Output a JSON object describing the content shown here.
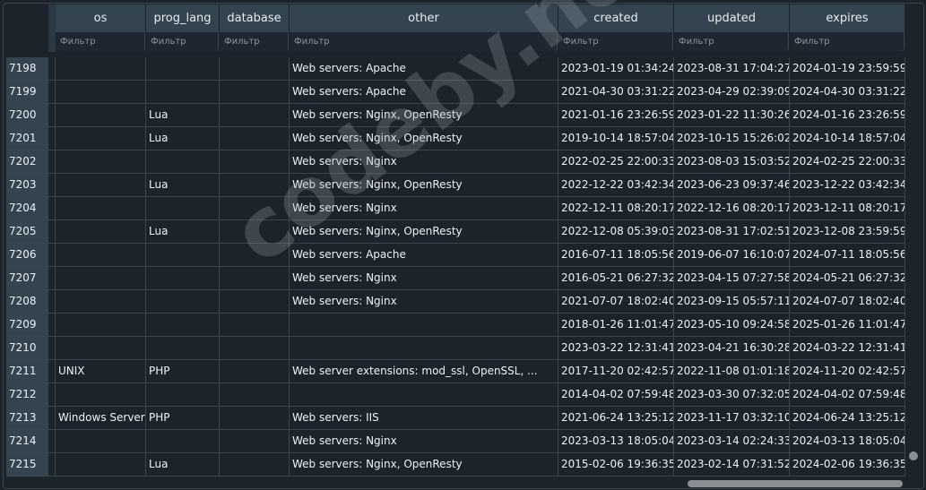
{
  "columns": [
    "os",
    "prog_lang",
    "database",
    "other",
    "created",
    "updated",
    "expires"
  ],
  "filter_placeholder": "Фильтр",
  "watermark": "codeby.net",
  "rows": [
    {
      "id": "7198",
      "os": "",
      "prog_lang": "",
      "database": "",
      "other": "Web servers: Apache",
      "created": "2023-01-19 01:34:24",
      "updated": "2023-08-31 17:04:27",
      "expires": "2024-01-19 23:59:59"
    },
    {
      "id": "7199",
      "os": "",
      "prog_lang": "",
      "database": "",
      "other": "Web servers: Apache",
      "created": "2021-04-30 03:31:22",
      "updated": "2023-04-29 02:39:09",
      "expires": "2024-04-30 03:31:22"
    },
    {
      "id": "7200",
      "os": "",
      "prog_lang": "Lua",
      "database": "",
      "other": "Web servers: Nginx, OpenResty",
      "created": "2021-01-16 23:26:59",
      "updated": "2023-01-22 11:30:26",
      "expires": "2024-01-16 23:26:59"
    },
    {
      "id": "7201",
      "os": "",
      "prog_lang": "Lua",
      "database": "",
      "other": "Web servers: Nginx, OpenResty",
      "created": "2019-10-14 18:57:04",
      "updated": "2023-10-15 15:26:02",
      "expires": "2024-10-14 18:57:04"
    },
    {
      "id": "7202",
      "os": "",
      "prog_lang": "",
      "database": "",
      "other": "Web servers: Nginx",
      "created": "2022-02-25 22:00:33",
      "updated": "2023-08-03 15:03:52",
      "expires": "2024-02-25 22:00:33"
    },
    {
      "id": "7203",
      "os": "",
      "prog_lang": "Lua",
      "database": "",
      "other": "Web servers: Nginx, OpenResty",
      "created": "2022-12-22 03:42:34",
      "updated": "2023-06-23 09:37:46",
      "expires": "2023-12-22 03:42:34"
    },
    {
      "id": "7204",
      "os": "",
      "prog_lang": "",
      "database": "",
      "other": "Web servers: Nginx",
      "created": "2022-12-11 08:20:17",
      "updated": "2022-12-16 08:20:17",
      "expires": "2023-12-11 08:20:17"
    },
    {
      "id": "7205",
      "os": "",
      "prog_lang": "Lua",
      "database": "",
      "other": "Web servers: Nginx, OpenResty",
      "created": "2022-12-08 05:39:03",
      "updated": "2023-08-31 17:02:51",
      "expires": "2023-12-08 23:59:59"
    },
    {
      "id": "7206",
      "os": "",
      "prog_lang": "",
      "database": "",
      "other": "Web servers: Apache",
      "created": "2016-07-11 18:05:56",
      "updated": "2019-06-07 16:10:07",
      "expires": "2024-07-11 18:05:56"
    },
    {
      "id": "7207",
      "os": "",
      "prog_lang": "",
      "database": "",
      "other": "Web servers: Nginx",
      "created": "2016-05-21 06:27:32",
      "updated": "2023-04-15 07:27:58",
      "expires": "2024-05-21 06:27:32"
    },
    {
      "id": "7208",
      "os": "",
      "prog_lang": "",
      "database": "",
      "other": "Web servers: Nginx",
      "created": "2021-07-07 18:02:40",
      "updated": "2023-09-15 05:57:11",
      "expires": "2024-07-07 18:02:40"
    },
    {
      "id": "7209",
      "os": "",
      "prog_lang": "",
      "database": "",
      "other": "",
      "created": "2018-01-26 11:01:47",
      "updated": "2023-05-10 09:24:58",
      "expires": "2025-01-26 11:01:47"
    },
    {
      "id": "7210",
      "os": "",
      "prog_lang": "",
      "database": "",
      "other": "",
      "created": "2023-03-22 12:31:41",
      "updated": "2023-04-21 16:30:28",
      "expires": "2024-03-22 12:31:41"
    },
    {
      "id": "7211",
      "os": "UNIX",
      "prog_lang": "PHP",
      "database": "",
      "other": "Web server extensions: mod_ssl, OpenSSL, ...",
      "created": "2017-11-20 02:42:57",
      "updated": "2022-11-08 01:01:18",
      "expires": "2024-11-20 02:42:57"
    },
    {
      "id": "7212",
      "os": "",
      "prog_lang": "",
      "database": "",
      "other": "",
      "created": "2014-04-02 07:59:48",
      "updated": "2023-03-30 07:32:05",
      "expires": "2024-04-02 07:59:48"
    },
    {
      "id": "7213",
      "os": "Windows Server",
      "prog_lang": "PHP",
      "database": "",
      "other": "Web servers: IIS",
      "created": "2021-06-24 13:25:12",
      "updated": "2023-11-17 03:32:10",
      "expires": "2024-06-24 13:25:12"
    },
    {
      "id": "7214",
      "os": "",
      "prog_lang": "",
      "database": "",
      "other": "Web servers: Nginx",
      "created": "2023-03-13 18:05:04",
      "updated": "2023-03-14 02:24:33",
      "expires": "2024-03-13 18:05:04"
    },
    {
      "id": "7215",
      "os": "",
      "prog_lang": "Lua",
      "database": "",
      "other": "Web servers: Nginx, OpenResty",
      "created": "2015-02-06 19:36:35",
      "updated": "2023-02-14 07:31:52",
      "expires": "2024-02-06 19:36:35"
    }
  ]
}
